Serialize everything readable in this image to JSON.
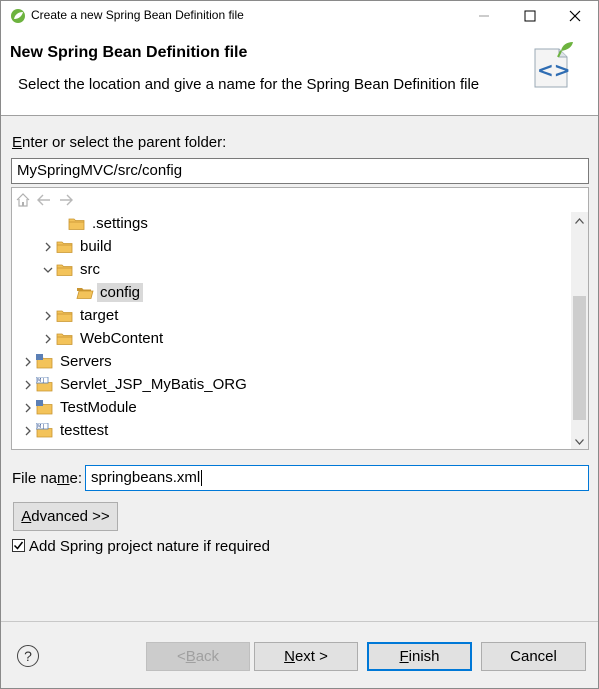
{
  "window": {
    "title": "Create a new Spring Bean Definition file",
    "minimize_label": "",
    "maximize_label": "",
    "close_label": ""
  },
  "banner": {
    "title": "New Spring Bean Definition file",
    "description": "Select the location and give a name for the Spring Bean Definition file",
    "icon": "spring-xml-file-icon"
  },
  "parent_folder": {
    "label_mnemonic": "E",
    "label_rest": "nter or select the parent folder:",
    "value": "MySpringMVC/src/config"
  },
  "tree": {
    "toolbar": [
      "home-icon",
      "back-icon",
      "forward-icon"
    ],
    "rows": [
      {
        "label": ".settings",
        "expander": "none",
        "icon": "folder-icon"
      },
      {
        "label": "build",
        "expander": "collapsed",
        "icon": "folder-icon"
      },
      {
        "label": "src",
        "expander": "expanded",
        "icon": "folder-icon"
      },
      {
        "label": "config",
        "expander": "none",
        "icon": "folder-open-icon",
        "selected": true
      },
      {
        "label": "target",
        "expander": "collapsed",
        "icon": "folder-icon"
      },
      {
        "label": "WebContent",
        "expander": "collapsed",
        "icon": "folder-icon"
      },
      {
        "label": "Servers",
        "expander": "collapsed",
        "icon": "project-icon"
      },
      {
        "label": "Servlet_JSP_MyBatis_ORG",
        "expander": "collapsed",
        "icon": "maven-project-icon"
      },
      {
        "label": "TestModule",
        "expander": "collapsed",
        "icon": "project-icon"
      },
      {
        "label": "testtest",
        "expander": "collapsed",
        "icon": "maven-project-icon"
      }
    ]
  },
  "file_name": {
    "label_pre": "File na",
    "label_mnemonic": "m",
    "label_post": "e:",
    "value": "springbeans.xml"
  },
  "advanced": {
    "mnemonic": "A",
    "rest": "dvanced >>"
  },
  "nature_checkbox": {
    "label": "Add Spring project nature if required",
    "checked": true
  },
  "footer": {
    "help_label": "?",
    "back": {
      "pre": "< ",
      "mnemonic": "B",
      "post": "ack"
    },
    "next": {
      "pre": "",
      "mnemonic": "N",
      "post": "ext >"
    },
    "finish": {
      "pre": "",
      "mnemonic": "F",
      "post": "inish"
    },
    "cancel": "Cancel"
  },
  "colors": {
    "accent": "#0078d7",
    "folder": "#e8b44c",
    "selection": "#d9d9d9"
  }
}
